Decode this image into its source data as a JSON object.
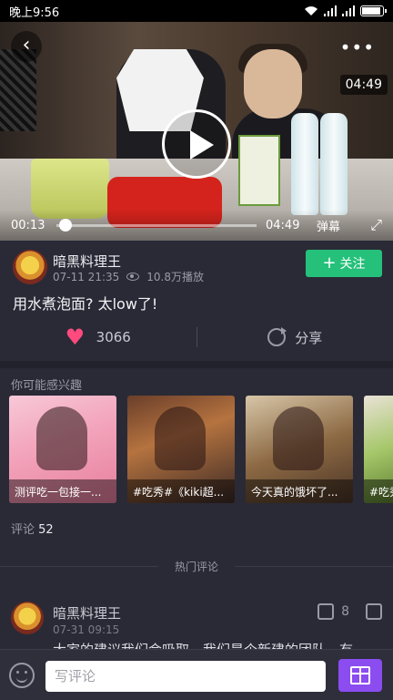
{
  "status_bar": {
    "time": "晚上9:56"
  },
  "video": {
    "duration_badge": "04:49",
    "current_time": "00:13",
    "total_time": "04:49",
    "danmu_label": "弹幕",
    "progress_fraction": 0.045
  },
  "uploader": {
    "name": "暗黑料理王",
    "date": "07-11 21:35",
    "views": "10.8万播放",
    "follow_label": "关注"
  },
  "post": {
    "title": "用水煮泡面? 太low了!"
  },
  "actions": {
    "likes": "3066",
    "share_label": "分享"
  },
  "recommendations": {
    "title": "你可能感兴趣",
    "items": [
      {
        "caption": "测评吃一包接一..."
      },
      {
        "caption": "#吃秀#《kiki超..."
      },
      {
        "caption": "今天真的饿坏了..."
      },
      {
        "caption": "#吃秀"
      }
    ]
  },
  "comments": {
    "count_label": "评论",
    "count": "52",
    "hot_label": "热门评论",
    "items": [
      {
        "user": "暗黑料理王",
        "time": "07-31 09:15",
        "likes": "8",
        "text": "大家的建议我们会吸取，我们是个新建的团队，有"
      }
    ]
  },
  "bottom_bar": {
    "input_placeholder": "写评论"
  },
  "colors": {
    "accent_green": "#25c07a",
    "heart_pink": "#ff4a7f",
    "gift_purple": "#8b4cf0",
    "background": "#2a2a36"
  }
}
